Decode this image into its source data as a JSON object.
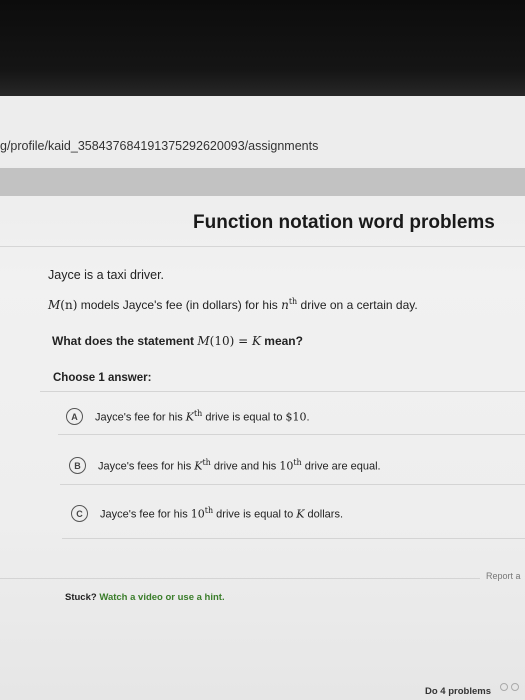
{
  "browser": {
    "url": "g/profile/kaid_358437684191375292620093/assignments"
  },
  "exercise": {
    "title": "Function notation word problems",
    "intro": "Jayce is a taxi driver.",
    "model_prefix_fn": "M",
    "model_prefix_arg": "(n)",
    "model_mid": " models Jayce's fee (in dollars) for his ",
    "model_var": "n",
    "model_sup": "th",
    "model_suffix": " drive on a certain day.",
    "question_prefix": "What does the statement ",
    "question_math_fn": "M",
    "question_math_arg": "(10) = ",
    "question_math_k": "K",
    "question_suffix": " mean?",
    "choose_label": "Choose 1 answer:",
    "choices": [
      {
        "letter": "A",
        "t1": "Jayce's fee for his ",
        "v1": "K",
        "s1": "th",
        "t2": " drive is equal to ",
        "v2": "$10",
        "t3": "."
      },
      {
        "letter": "B",
        "t1": "Jayce's fees for his ",
        "v1": "K",
        "s1": "th",
        "t2": " drive and his ",
        "v2": "10",
        "s2": "th",
        "t3": " drive are equal."
      },
      {
        "letter": "C",
        "t1": "Jayce's fee for his ",
        "v1": "10",
        "s1": "th",
        "t2": " drive is equal to ",
        "v2": "K",
        "t3": " dollars."
      }
    ]
  },
  "footer": {
    "report_label": "Report a",
    "stuck_label": "Stuck?",
    "stuck_link": "Watch a video or use a hint.",
    "do_problems_label": "Do 4 problems"
  },
  "colors": {
    "link_green": "#3a7d2a",
    "header_band": "#c2c2c2"
  }
}
